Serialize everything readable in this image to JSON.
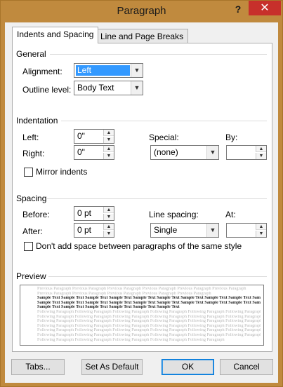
{
  "window": {
    "title": "Paragraph",
    "help_glyph": "?",
    "close_glyph": "✕"
  },
  "tabs": [
    {
      "label": "Indents and Spacing",
      "active": true
    },
    {
      "label": "Line and Page Breaks",
      "active": false
    }
  ],
  "general": {
    "heading": "General",
    "alignment_label": "Alignment:",
    "alignment_value": "Left",
    "outline_label": "Outline level:",
    "outline_value": "Body Text"
  },
  "indentation": {
    "heading": "Indentation",
    "left_label": "Left:",
    "left_value": "0\"",
    "right_label": "Right:",
    "right_value": "0\"",
    "special_label": "Special:",
    "special_value": "(none)",
    "by_label": "By:",
    "by_value": "",
    "mirror_label": "Mirror indents",
    "mirror_checked": false
  },
  "spacing": {
    "heading": "Spacing",
    "before_label": "Before:",
    "before_value": "0 pt",
    "after_label": "After:",
    "after_value": "0 pt",
    "line_spacing_label": "Line spacing:",
    "line_spacing_value": "Single",
    "at_label": "At:",
    "at_value": "",
    "dont_add_label": "Don't add space between paragraphs of the same style",
    "dont_add_checked": false
  },
  "preview": {
    "heading": "Preview",
    "previous_lines": [
      "Previous Paragraph Previous Paragraph Previous Paragraph Previous Paragraph Previous Paragraph Previous Paragraph",
      "Previous Paragraph Previous Paragraph Previous Paragraph Previous Paragraph Previous Paragraph"
    ],
    "sample_lines": [
      "Sample Text Sample Text Sample Text Sample Text Sample Text Sample Text Sample Text Sample Text Sample Text Sample Text",
      "Sample Text Sample Text Sample Text Sample Text Sample Text Sample Text Sample Text Sample Text Sample Text Sample Text",
      "Sample Text Sample Text Sample Text Sample Text Sample Text Sample Text"
    ],
    "following_lines": [
      "Following Paragraph Following Paragraph Following Paragraph Following Paragraph Following Paragraph Following Paragraph",
      "Following Paragraph Following Paragraph Following Paragraph Following Paragraph Following Paragraph Following Paragraph",
      "Following Paragraph Following Paragraph Following Paragraph Following Paragraph Following Paragraph Following Paragraph",
      "Following Paragraph Following Paragraph Following Paragraph Following Paragraph Following Paragraph Following Paragraph",
      "Following Paragraph Following Paragraph Following Paragraph Following Paragraph Following Paragraph Following Paragraph",
      "Following Paragraph Following Paragraph Following Paragraph Following Paragraph Following Paragraph Following Paragraph",
      "Following Paragraph Following Paragraph Following Paragraph Following Paragraph Following Paragraph"
    ]
  },
  "buttons": {
    "tabs": "Tabs...",
    "set_default": "Set As Default",
    "ok": "OK",
    "cancel": "Cancel"
  },
  "icons": {
    "dropdown": "chevron-down-icon",
    "spin_up": "spin-up-icon",
    "spin_down": "spin-down-icon"
  },
  "colors": {
    "title_bar": "#c08a3e",
    "close_button": "#c7302b",
    "selection": "#3399ff",
    "default_button_border": "#0078d7"
  }
}
